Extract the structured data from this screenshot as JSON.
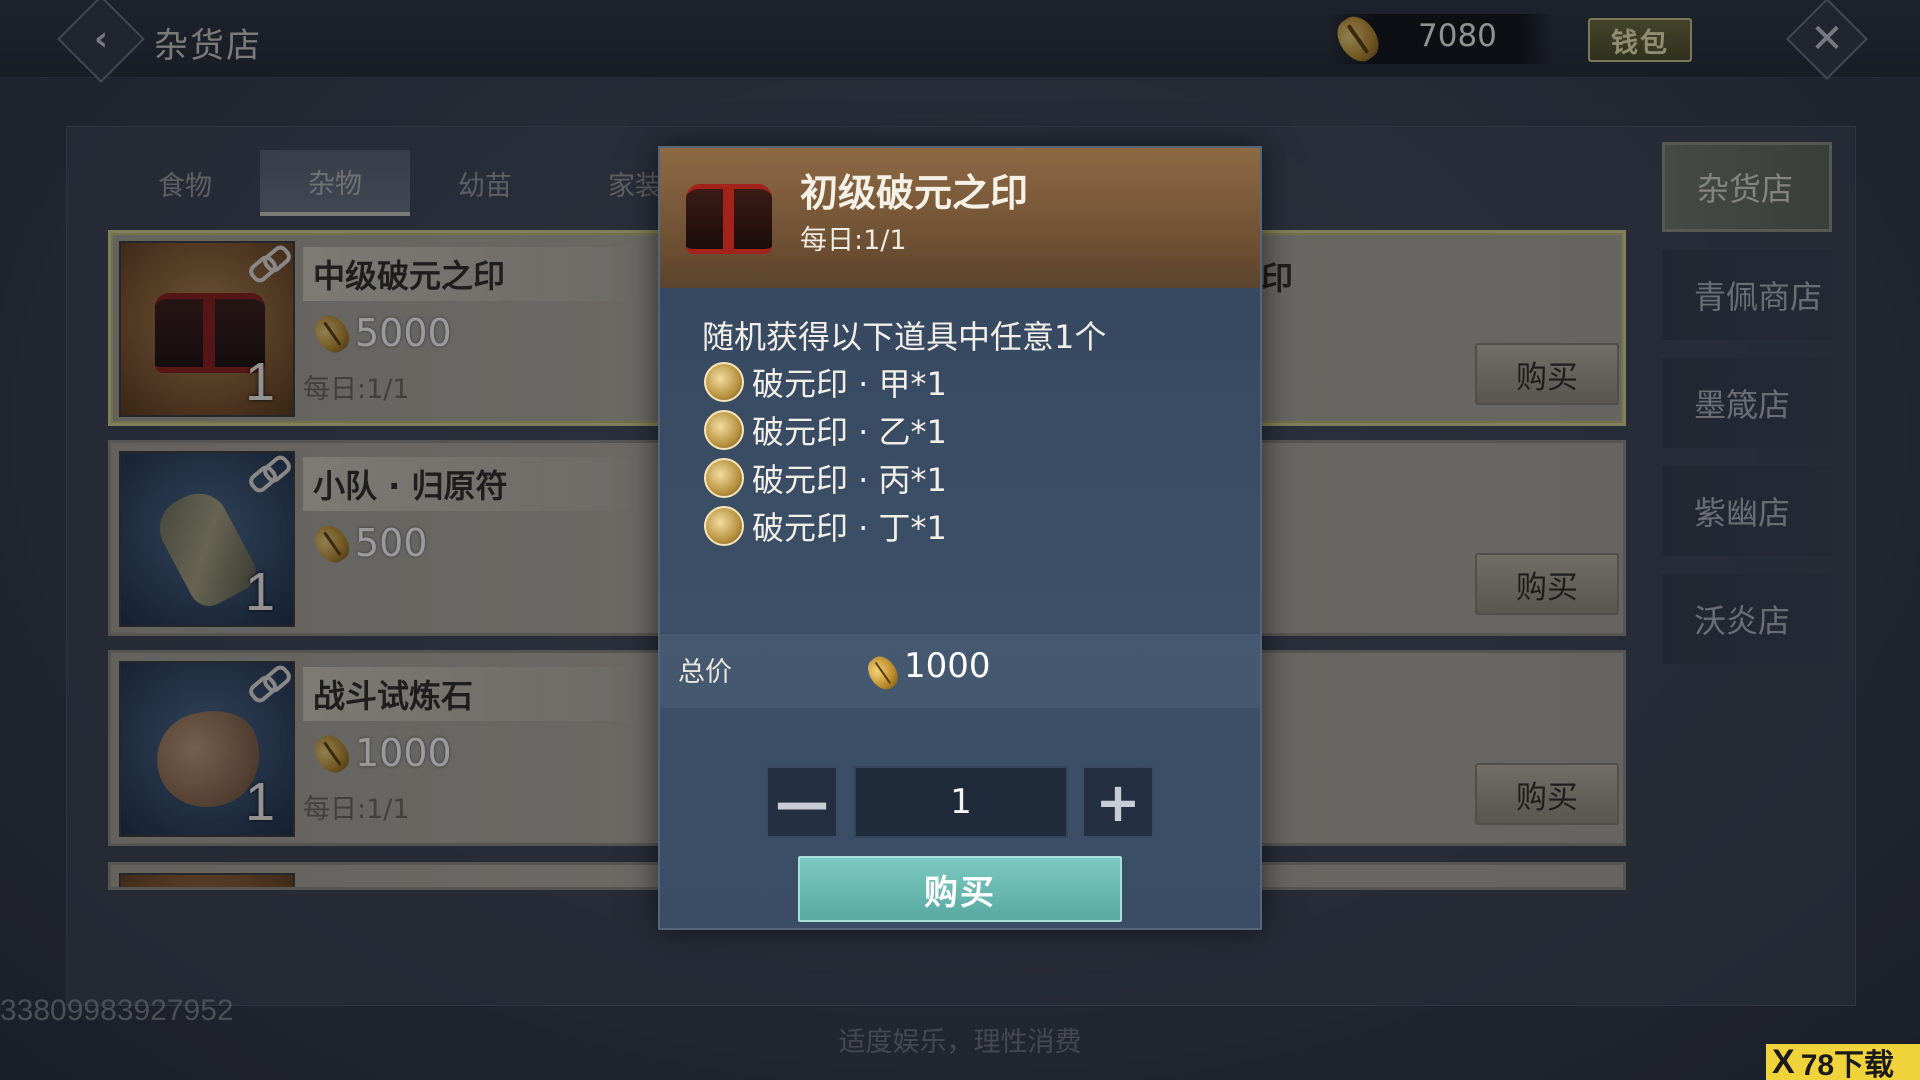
{
  "header": {
    "back_icon": "back-arrow-icon",
    "title": "杂货店",
    "currency_icon": "shell-coin-icon",
    "currency_amount": "7080",
    "wallet_label": "钱包",
    "close_icon": "close-x-icon"
  },
  "tabs": [
    {
      "label": "食物",
      "active": false
    },
    {
      "label": "杂物",
      "active": true
    },
    {
      "label": "幼苗",
      "active": false
    },
    {
      "label": "家装",
      "active": false
    }
  ],
  "items": [
    {
      "name": "中级破元之印",
      "price": "5000",
      "limit": "每日:1/1",
      "count": "1",
      "icon": "chest-icon",
      "selected": true,
      "buy_label": "购买",
      "right_ghost": "印"
    },
    {
      "name": "小队 · 归原符",
      "price": "500",
      "limit": "",
      "count": "1",
      "icon": "scroll-icon",
      "selected": false,
      "buy_label": "购买",
      "right_ghost": ""
    },
    {
      "name": "战斗试炼石",
      "price": "1000",
      "limit": "每日:1/1",
      "count": "1",
      "icon": "rock-icon",
      "selected": false,
      "buy_label": "购买",
      "right_ghost": ""
    }
  ],
  "side_nav": [
    {
      "label": "杂货店",
      "active": true
    },
    {
      "label": "青佩商店",
      "active": false
    },
    {
      "label": "墨箴店",
      "active": false
    },
    {
      "label": "紫幽店",
      "active": false
    },
    {
      "label": "沃炎店",
      "active": false
    }
  ],
  "popup": {
    "title": "初级破元之印",
    "limit": "每日:1/1",
    "description": "随机获得以下道具中任意1个",
    "rewards": [
      {
        "label": "破元印 · 甲*1",
        "icon": "seal-jia-icon"
      },
      {
        "label": "破元印 · 乙*1",
        "icon": "seal-yi-icon"
      },
      {
        "label": "破元印 · 丙*1",
        "icon": "seal-bing-icon"
      },
      {
        "label": "破元印 · 丁*1",
        "icon": "seal-ding-icon"
      }
    ],
    "total_label": "总价",
    "total_value": "1000",
    "quantity": "1",
    "minus_label": "—",
    "plus_label": "+",
    "buy_label": "购买"
  },
  "footer": {
    "player_id": "33809983927952",
    "notice": "适度娱乐，理性消费",
    "site_badge_x": "X",
    "site_badge_text": "78下载"
  },
  "colors": {
    "accent_teal": "#58a9a2",
    "wallet_gold": "#c9c48c",
    "header_brown": "#8e6a45"
  }
}
